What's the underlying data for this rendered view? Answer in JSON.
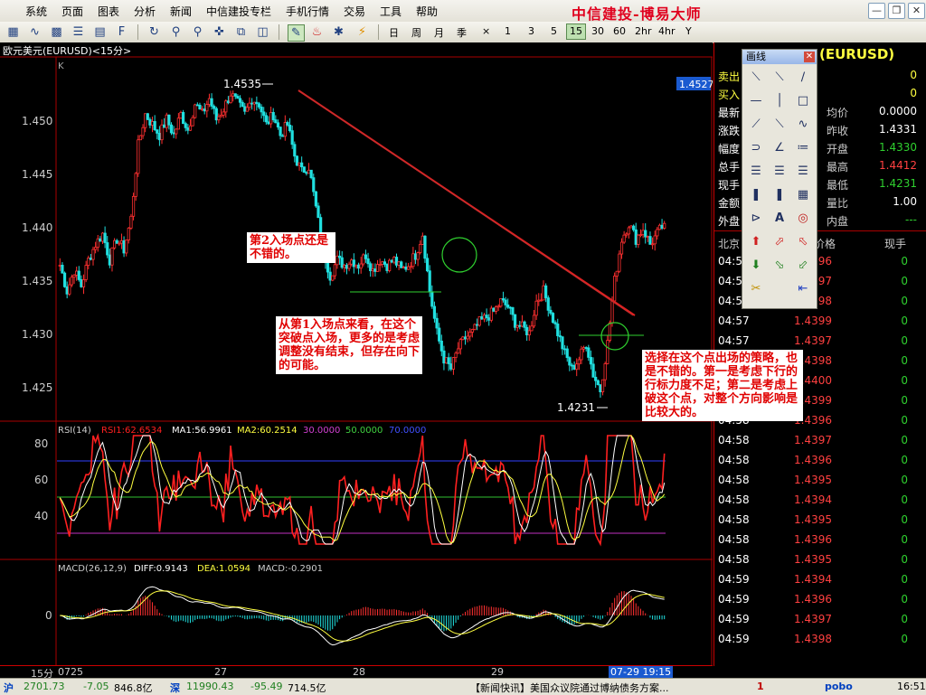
{
  "menu": {
    "items": [
      "系统",
      "页面",
      "图表",
      "分析",
      "新闻",
      "中信建投专栏",
      "手机行情",
      "交易",
      "工具",
      "帮助"
    ],
    "logo": "中信建投-博易大师"
  },
  "toolbar": {
    "periods": [
      "日",
      "周",
      "月",
      "季",
      "×",
      "1",
      "3",
      "5",
      "15",
      "30",
      "60",
      "2hr",
      "4hr",
      "Y"
    ],
    "active_period": "15"
  },
  "chart": {
    "title": "欧元美元(EURUSD)<15分>",
    "k_label": "K",
    "current_price": "1.4527",
    "high_label": "1.4535",
    "low_label": "1.4231",
    "period_label": "15分",
    "date_labels": [
      "0725",
      "27",
      "28",
      "29",
      "07-29 19:15"
    ]
  },
  "rsi": {
    "name": "RSI(14)",
    "rsi1": "RSI1:62.6534",
    "ma1": "MA1:56.9961",
    "ma2": "MA2:60.2514",
    "l30": "30.0000",
    "l50": "50.0000",
    "l70": "70.0000"
  },
  "macd": {
    "name": "MACD(26,12,9)",
    "diff": "DIFF:0.9143",
    "dea": "DEA:1.0594",
    "macd": "MACD:-0.2901"
  },
  "chart_data": {
    "type": "candlestick",
    "title": "欧元美元(EURUSD)<15分>",
    "y_ticks": [
      "1.450",
      "1.445",
      "1.440",
      "1.435",
      "1.430",
      "1.425"
    ],
    "ylim": [
      1.4215,
      1.4565
    ],
    "high": 1.4535,
    "low": 1.4231,
    "last": 1.4527,
    "rsi_ticks": [
      "80",
      "60",
      "40"
    ],
    "rsi_levels": [
      30,
      50,
      70
    ],
    "macd_ticks": [
      "0"
    ],
    "x_labels": [
      "0725",
      "27",
      "28",
      "29",
      "07-29 19:15"
    ],
    "close_path": [
      1.4365,
      1.434,
      1.436,
      1.4345,
      1.437,
      1.4385,
      1.4395,
      1.437,
      1.439,
      1.438,
      1.441,
      1.448,
      1.451,
      1.45,
      1.449,
      1.4505,
      1.449,
      1.451,
      1.4495,
      1.452,
      1.451,
      1.4525,
      1.4505,
      1.4515,
      1.453,
      1.452,
      1.451,
      1.4525,
      1.452,
      1.45,
      1.451,
      1.449,
      1.45,
      1.447,
      1.4455,
      1.446,
      1.442,
      1.438,
      1.4355,
      1.437,
      1.4365,
      1.437,
      1.4365,
      1.4375,
      1.436,
      1.437,
      1.4365,
      1.437,
      1.436,
      1.4365,
      1.4375,
      1.4395,
      1.434,
      1.43,
      1.4275,
      1.4265,
      1.4285,
      1.4295,
      1.43,
      1.431,
      1.4315,
      1.432,
      1.433,
      1.4325,
      1.431,
      1.4305,
      1.43,
      1.433,
      1.434,
      1.432,
      1.43,
      1.428,
      1.4265,
      1.4275,
      1.429,
      1.426,
      1.4245,
      1.429,
      1.435,
      1.439,
      1.4405,
      1.439,
      1.44,
      1.4385,
      1.4395,
      1.4405
    ]
  },
  "annotations": {
    "note1": "第2入场点还是不错的。",
    "note2": "从第1入场点来看，在这个突破点入场，更多的是考虑调整没有结束，但存在向下的可能。",
    "note3": "选择在这个点出场的策略，也是不错的。第一是考虑下行的行标力度不足；第二是考虑上破这个点，对整个方向影响是比较大的。"
  },
  "palette": {
    "title": "画线"
  },
  "quote": {
    "symbol": "(EURUSD)",
    "rows": [
      {
        "l1": "卖出",
        "v1": "",
        "l2": "",
        "v2": "0"
      },
      {
        "l1": "买入",
        "v1": "",
        "l2": "",
        "v2": "0"
      },
      {
        "l1": "最新",
        "v1": "",
        "l2": "均价",
        "v2": "0.0000"
      },
      {
        "l1": "涨跌",
        "v1": "",
        "l2": "昨收",
        "v2": "1.4331"
      },
      {
        "l1": "幅度",
        "v1": "",
        "l2": "开盘",
        "v2": "1.4330"
      },
      {
        "l1": "总手",
        "v1": "",
        "l2": "最高",
        "v2": "1.4412"
      },
      {
        "l1": "现手",
        "v1": "",
        "l2": "最低",
        "v2": "1.4231"
      },
      {
        "l1": "金额",
        "v1": "",
        "l2": "量比",
        "v2": "1.00"
      },
      {
        "l1": "外盘",
        "v1": "",
        "l2": "内盘",
        "v2": "---"
      }
    ],
    "tick_header": {
      "time": "北京",
      "price": "价格",
      "vol": "现手"
    },
    "ticks": [
      {
        "t": "04:57",
        "p": "1.4396",
        "v": "0"
      },
      {
        "t": "04:57",
        "p": "1.4397",
        "v": "0"
      },
      {
        "t": "04:57",
        "p": "1.4398",
        "v": "0"
      },
      {
        "t": "04:57",
        "p": "1.4399",
        "v": "0"
      },
      {
        "t": "04:57",
        "p": "1.4397",
        "v": "0"
      },
      {
        "t": "04:57",
        "p": "1.4398",
        "v": "0"
      },
      {
        "t": "04:58",
        "p": "1.4400",
        "v": "0"
      },
      {
        "t": "04:58",
        "p": "1.4399",
        "v": "0"
      },
      {
        "t": "04:58",
        "p": "1.4396",
        "v": "0"
      },
      {
        "t": "04:58",
        "p": "1.4397",
        "v": "0"
      },
      {
        "t": "04:58",
        "p": "1.4396",
        "v": "0"
      },
      {
        "t": "04:58",
        "p": "1.4395",
        "v": "0"
      },
      {
        "t": "04:58",
        "p": "1.4394",
        "v": "0"
      },
      {
        "t": "04:58",
        "p": "1.4395",
        "v": "0"
      },
      {
        "t": "04:58",
        "p": "1.4396",
        "v": "0"
      },
      {
        "t": "04:58",
        "p": "1.4395",
        "v": "0"
      },
      {
        "t": "04:59",
        "p": "1.4394",
        "v": "0"
      },
      {
        "t": "04:59",
        "p": "1.4396",
        "v": "0"
      },
      {
        "t": "04:59",
        "p": "1.4397",
        "v": "0"
      },
      {
        "t": "04:59",
        "p": "1.4398",
        "v": "0"
      }
    ]
  },
  "status": {
    "sh_label": "沪",
    "sh_index": "2701.73",
    "sh_chg": "-7.05",
    "sh_amt": "846.8亿",
    "sz_label": "深",
    "sz_index": "11990.43",
    "sz_chg": "-95.49",
    "sz_amt": "714.5亿",
    "news": "【新闻快讯】美国众议院通过博纳债务方案...",
    "alert": "1",
    "brand": "pobo",
    "time": "16:51"
  }
}
